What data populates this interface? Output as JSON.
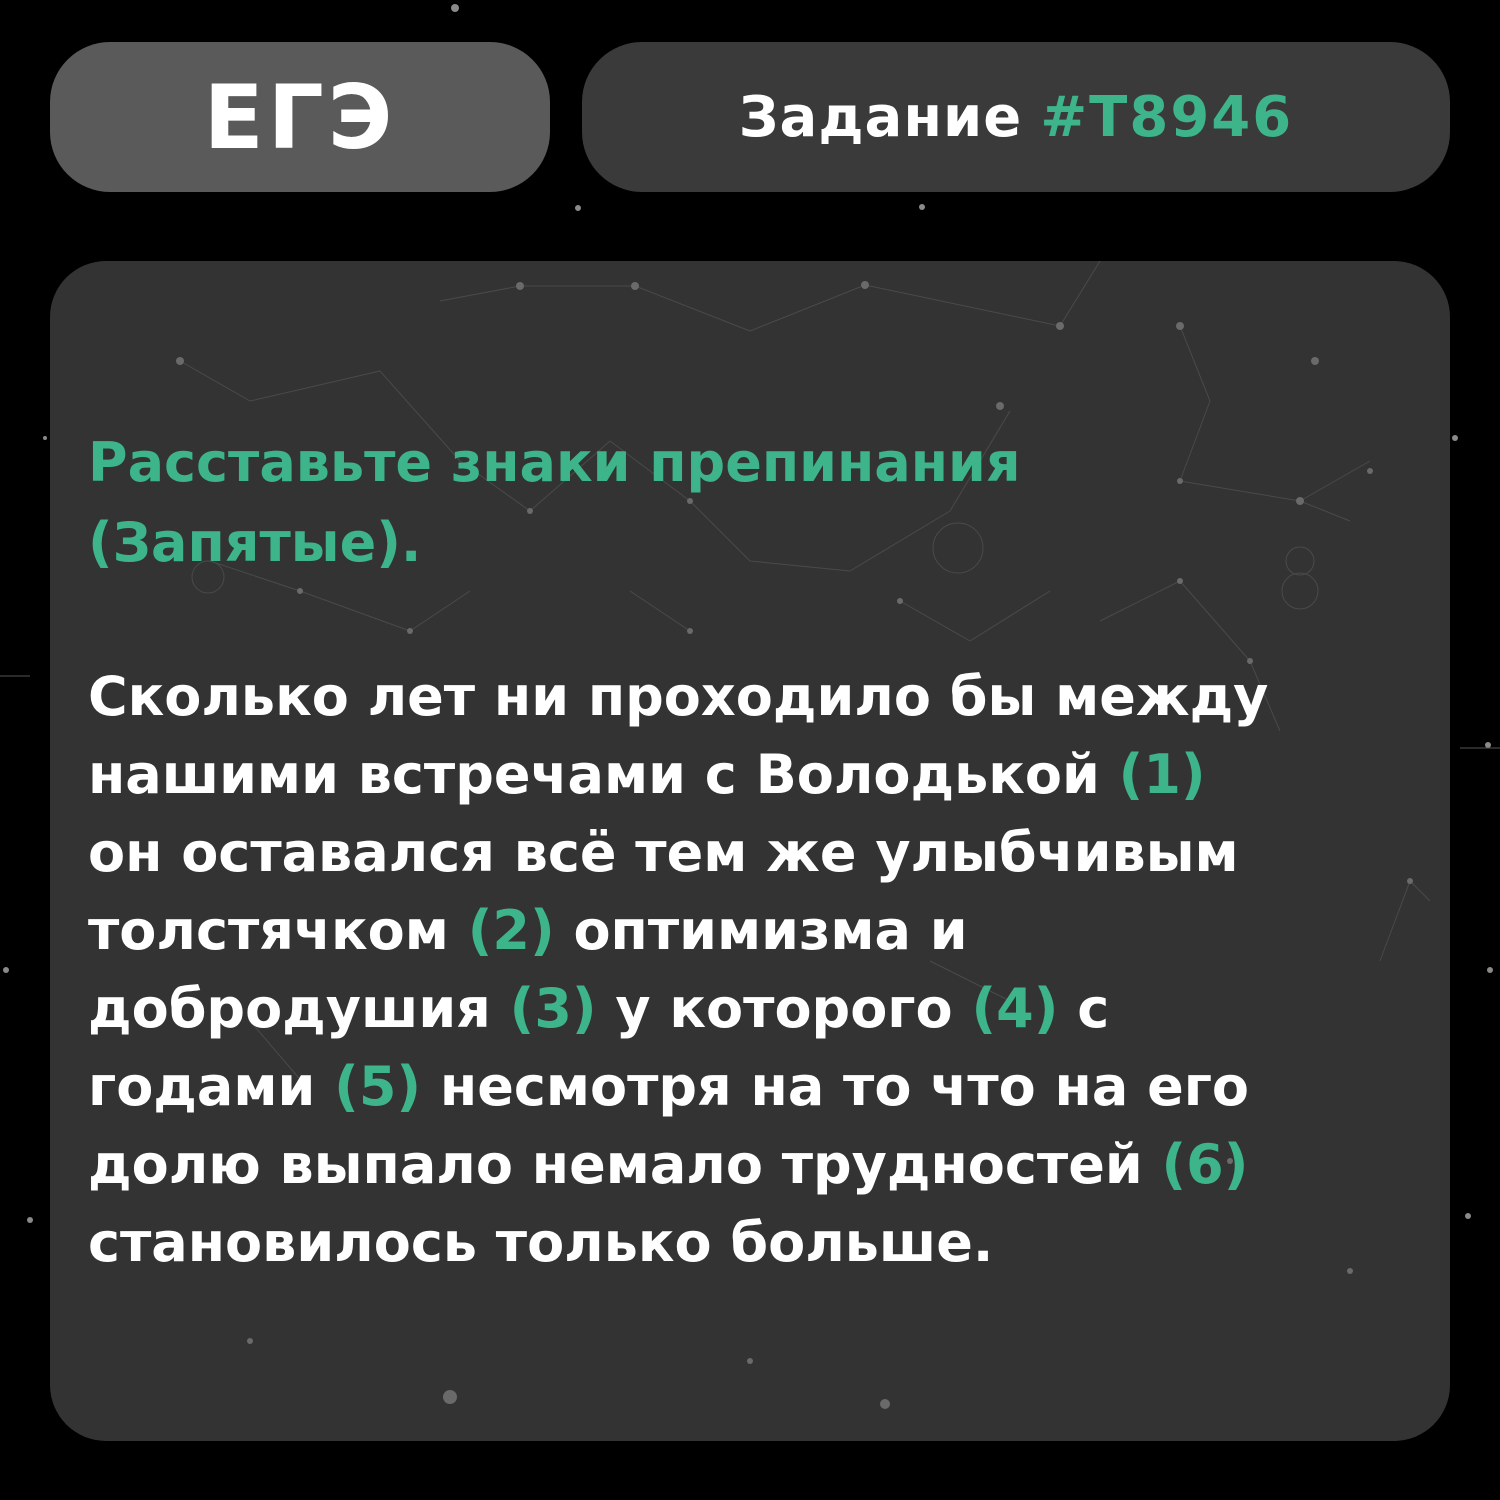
{
  "header": {
    "exam_label": "ЕГЭ",
    "task_word": "Задание",
    "task_id": "#T8946"
  },
  "card": {
    "instruction_lines": [
      "Расставьте знаки препинания",
      "(Запятые)."
    ],
    "text_segments": {
      "l1": "Сколько лет ни проходило бы между",
      "l2a": "нашими встречами с Володькой",
      "m1": "(1)",
      "l3": "он оставался всё тем же улыбчивым",
      "l4a": "толстячком",
      "m2": "(2)",
      "l4b": "оптимизма и",
      "l5a": "добродушия",
      "m3": "(3)",
      "l5b": "у которого",
      "m4": "(4)",
      "l5c": "с",
      "l6a": "годами",
      "m5": "(5)",
      "l6b": "несмотря на то что на его",
      "l7a": "долю выпало немало трудностей",
      "m6": "(6)",
      "l8": "становилось только больше."
    }
  },
  "colors": {
    "accent": "#3db48a",
    "background": "#000000",
    "card": "#333333",
    "exam_badge": "#5a5a5a",
    "task_badge": "#3a3a3a",
    "text": "#ffffff"
  }
}
